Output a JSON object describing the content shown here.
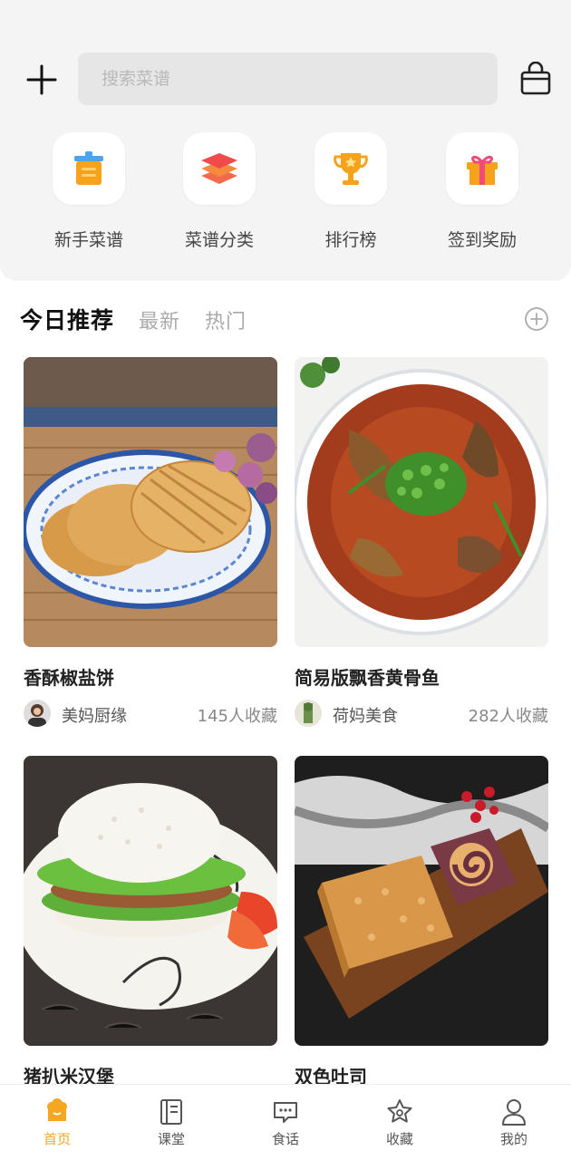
{
  "header": {
    "search_placeholder": "搜索菜谱",
    "add_icon": "plus-icon",
    "basket_icon": "shopping-basket-icon"
  },
  "quick_entries": [
    {
      "label": "新手菜谱",
      "icon": "pot-icon"
    },
    {
      "label": "菜谱分类",
      "icon": "layers-icon"
    },
    {
      "label": "排行榜",
      "icon": "trophy-icon"
    },
    {
      "label": "签到奖励",
      "icon": "gift-icon"
    }
  ],
  "tabs": [
    {
      "label": "今日推荐",
      "active": true
    },
    {
      "label": "最新",
      "active": false
    },
    {
      "label": "热门",
      "active": false
    }
  ],
  "recipes": [
    {
      "title": "香酥椒盐饼",
      "author": "美妈厨缘",
      "favorites": "145人收藏",
      "image": "grilled-flatbread-photo"
    },
    {
      "title": "简易版飘香黄骨鱼",
      "author": "荷妈美食",
      "favorites": "282人收藏",
      "image": "yellow-catfish-stew-photo"
    },
    {
      "title": "猪扒米汉堡",
      "author": "",
      "favorites": "",
      "image": "rice-burger-photo"
    },
    {
      "title": "双色吐司",
      "author": "",
      "favorites": "",
      "image": "two-color-toast-photo"
    }
  ],
  "bottom_nav": [
    {
      "label": "首页",
      "icon": "home-chef-icon",
      "active": true
    },
    {
      "label": "课堂",
      "icon": "book-icon",
      "active": false
    },
    {
      "label": "食话",
      "icon": "chat-bubble-icon",
      "active": false
    },
    {
      "label": "收藏",
      "icon": "star-icon",
      "active": false
    },
    {
      "label": "我的",
      "icon": "user-icon",
      "active": false
    }
  ],
  "colors": {
    "accent": "#f5a623",
    "panel_bg": "#f4f4f4",
    "search_bg": "#e6e6e6"
  }
}
